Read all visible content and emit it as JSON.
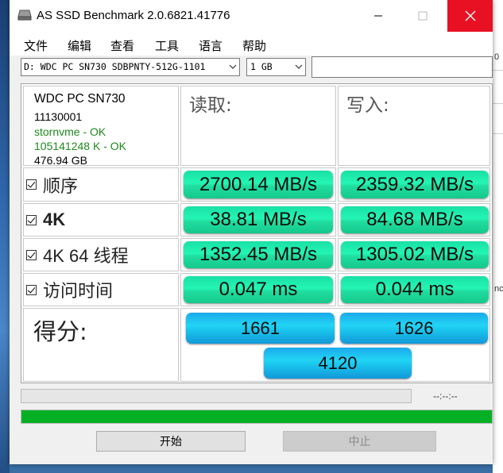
{
  "window": {
    "title": "AS SSD Benchmark 2.0.6821.41776"
  },
  "menu": [
    "文件",
    "编辑",
    "查看",
    "工具",
    "语言",
    "帮助"
  ],
  "toolbar": {
    "drive": "D: WDC PC SN730 SDBPNTY-512G-1101",
    "size": "1 GB",
    "text_value": ""
  },
  "drive_info": {
    "model": "WDC PC SN730",
    "firmware": "11130001",
    "driver": "stornvme - OK",
    "alignment": "105141248 K - OK",
    "capacity": "476.94 GB"
  },
  "columns": {
    "read": "读取:",
    "write": "写入:"
  },
  "tests": [
    {
      "label": "顺序",
      "read": "2700.14 MB/s",
      "write": "2359.32 MB/s",
      "checked": true
    },
    {
      "label": "4K",
      "read": "38.81 MB/s",
      "write": "84.68 MB/s",
      "checked": true
    },
    {
      "label": "4K 64 线程",
      "read": "1352.45 MB/s",
      "write": "1305.02 MB/s",
      "checked": true
    },
    {
      "label": "访问时间",
      "read": "0.047 ms",
      "write": "0.044 ms",
      "checked": true
    }
  ],
  "score": {
    "label": "得分:",
    "read": "1661",
    "write": "1626",
    "total": "4120"
  },
  "progress": {
    "time": "--:--:--",
    "top_fraction": 0.0,
    "bottom_fraction": 1.0
  },
  "buttons": {
    "start": "开始",
    "stop": "中止"
  },
  "colors": {
    "result_green": "#24f5b4",
    "score_cyan": "#22d4f4",
    "progress_green": "#06b025",
    "close_red": "#e81123"
  },
  "background": {
    "fragment_1": "0",
    "fragment_2": "nc"
  }
}
